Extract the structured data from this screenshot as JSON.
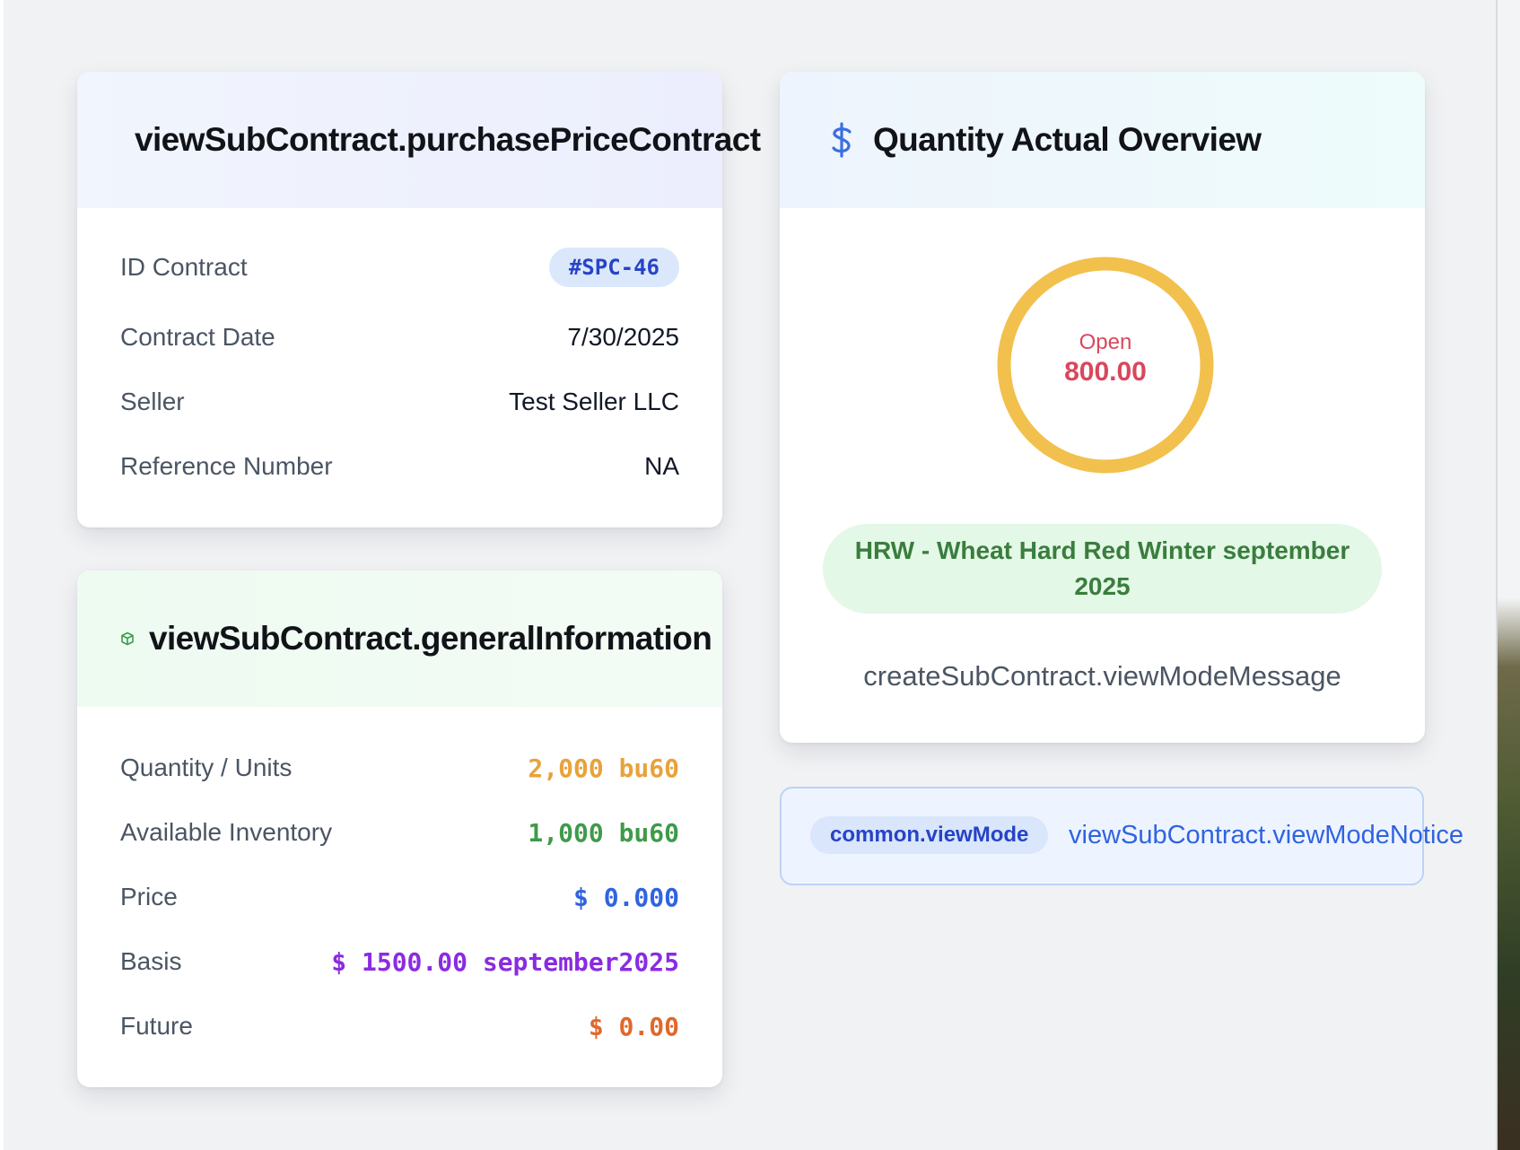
{
  "purchase_card": {
    "title": "viewSubContract.purchasePriceContract",
    "rows": [
      {
        "label": "ID Contract",
        "value": "#SPC-46"
      },
      {
        "label": "Contract Date",
        "value": "7/30/2025"
      },
      {
        "label": "Seller",
        "value": "Test Seller LLC"
      },
      {
        "label": "Reference Number",
        "value": "NA"
      }
    ]
  },
  "general_card": {
    "title": "viewSubContract.generalInformation",
    "icon": "cube-icon",
    "rows": [
      {
        "label": "Quantity / Units",
        "value": "2,000 bu60",
        "color": "#e8a23b"
      },
      {
        "label": "Available Inventory",
        "value": "1,000 bu60",
        "color": "#3f9a4a"
      },
      {
        "label": "Price",
        "value": "$ 0.000",
        "color": "#2f63e0"
      },
      {
        "label": "Basis",
        "value": "$ 1500.00 september2025",
        "color": "#8a2be2"
      },
      {
        "label": "Future",
        "value": "$ 0.00",
        "color": "#e0682b"
      }
    ]
  },
  "quantity_card": {
    "title": "Quantity Actual Overview",
    "icon": "dollar-icon",
    "gauge": {
      "label": "Open",
      "value": "800.00",
      "ring_color": "#f2c04c",
      "text_color": "#d9475b"
    },
    "commodity": "HRW - Wheat Hard Red Winter september 2025",
    "message": "createSubContract.viewModeMessage"
  },
  "notice": {
    "badge": "common.viewMode",
    "text": "viewSubContract.viewModeNotice"
  }
}
